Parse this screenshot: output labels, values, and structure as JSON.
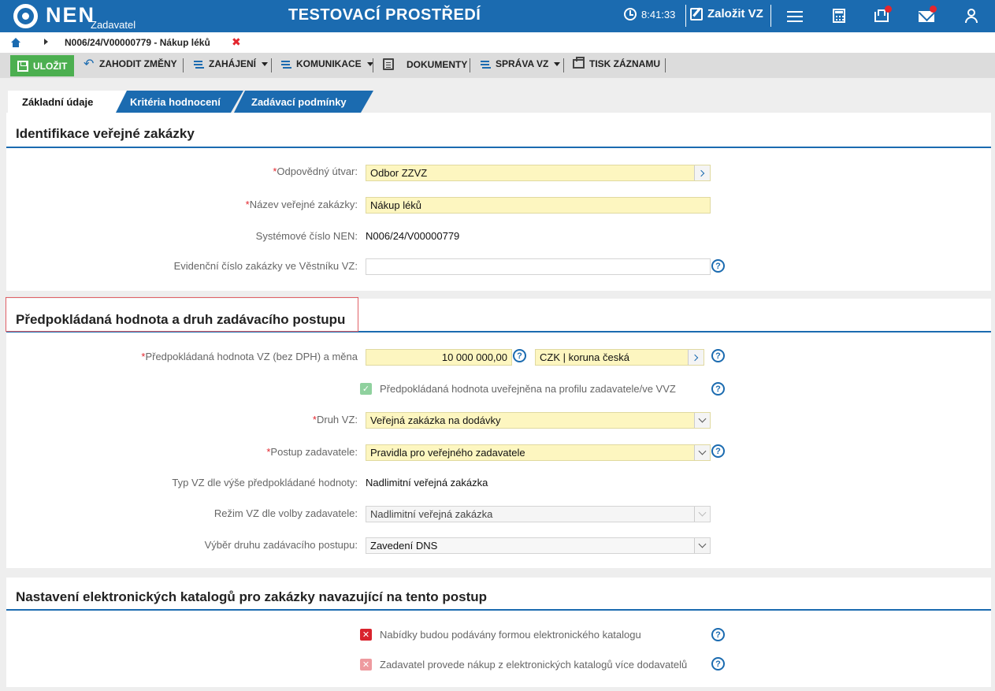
{
  "topbar": {
    "logo": "NEN",
    "logo_sub": "Zadavatel",
    "env_title": "TESTOVACÍ PROSTŘEDÍ",
    "time": "8:41:33",
    "create_label": "Založit VZ",
    "icons": [
      "menu-icon",
      "calculator-icon",
      "inbox-icon",
      "mail-icon",
      "user-icon"
    ],
    "accent": "#1b6bb0",
    "alert_color": "#e3262e"
  },
  "breadcrumb": {
    "current": "N006/24/V00000779 - Nákup léků",
    "close": "✖"
  },
  "toolbar": {
    "save": "ULOŽIT",
    "discard": "ZAHODIT ZMĚNY",
    "start": "ZAHÁJENÍ",
    "communication": "KOMUNIKACE",
    "documents": "DOKUMENTY",
    "management": "SPRÁVA VZ",
    "print": "TISK ZÁZNAMU"
  },
  "tabs": [
    {
      "label": "Základní údaje",
      "active": true
    },
    {
      "label": "Kritéria hodnocení",
      "active": false
    },
    {
      "label": "Zadávací podmínky",
      "active": false
    }
  ],
  "section1": {
    "title": "Identifikace veřejné zakázky",
    "unit_label": "Odpovědný útvar:",
    "unit_value": "Odbor ZZVZ",
    "name_label": "Název veřejné zakázky:",
    "name_value": "Nákup léků",
    "sysnum_label": "Systémové číslo NEN:",
    "sysnum_value": "N006/24/V00000779",
    "evid_label": "Evidenční číslo zakázky ve Věstníku VZ:",
    "evid_value": ""
  },
  "section2": {
    "title": "Předpokládaná hodnota a druh zadávacího postupu",
    "value_label": "Předpokládaná hodnota VZ (bez DPH) a měna",
    "value": "10 000 000,00",
    "currency": "CZK | koruna česká",
    "published_label": "Předpokládaná hodnota uveřejněna na profilu zadavatele/ve VVZ",
    "published_checked": true,
    "kind_label": "Druh VZ:",
    "kind_value": "Veřejná zakázka na dodávky",
    "procedure_label": "Postup zadavatele:",
    "procedure_value": "Pravidla pro veřejného zadavatele",
    "type_label": "Typ VZ dle výše předpokládané hodnoty:",
    "type_value": "Nadlimitní veřejná zakázka",
    "regime_label": "Režim VZ dle volby zadavatele:",
    "regime_value": "Nadlimitní veřejná zakázka",
    "choice_label": "Výběr druhu zadávacího postupu:",
    "choice_value": "Zavedení DNS"
  },
  "section3": {
    "title": "Nastavení elektronických katalogů pro zakázky navazující na tento postup",
    "opt1_label": "Nabídky budou podávány formou elektronického katalogu",
    "opt1_checked": false,
    "opt2_label": "Zadavatel provede nákup z elektronických katalogů více dodavatelů",
    "opt2_checked": false
  },
  "help_glyph": "?",
  "check_glyph": "✓",
  "cross_glyph": "✕"
}
